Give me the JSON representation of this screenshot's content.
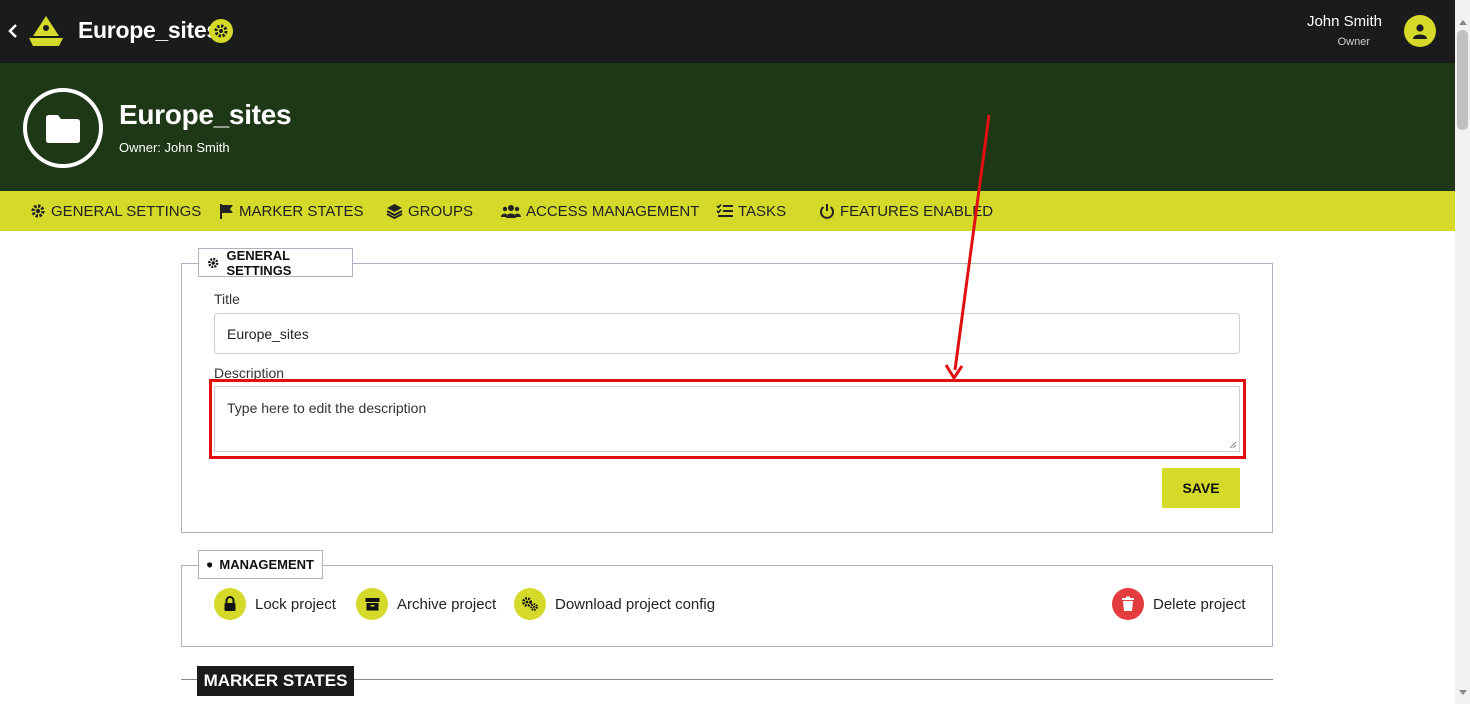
{
  "topbar": {
    "app_title": "Europe_sites",
    "user_name": "John Smith",
    "user_role": "Owner"
  },
  "header": {
    "project_title": "Europe_sites",
    "owner_line": "Owner: John Smith"
  },
  "tabs": [
    {
      "label": "GENERAL SETTINGS",
      "icon": "gear-icon"
    },
    {
      "label": "MARKER STATES",
      "icon": "flag-icon"
    },
    {
      "label": "GROUPS",
      "icon": "layers-icon"
    },
    {
      "label": "ACCESS MANAGEMENT",
      "icon": "users-icon"
    },
    {
      "label": "TASKS",
      "icon": "checklist-icon"
    },
    {
      "label": "FEATURES ENABLED",
      "icon": "power-icon"
    }
  ],
  "general_settings": {
    "legend": "GENERAL SETTINGS",
    "title_label": "Title",
    "title_value": "Europe_sites",
    "description_label": "Description",
    "description_placeholder": "Type here to edit the description",
    "save_label": "SAVE"
  },
  "management": {
    "legend": "MANAGEMENT",
    "actions": [
      {
        "label": "Lock project",
        "icon": "lock-icon"
      },
      {
        "label": "Archive project",
        "icon": "archive-icon"
      },
      {
        "label": "Download project config",
        "icon": "gears-icon"
      },
      {
        "label": "Delete project",
        "icon": "trash-icon"
      }
    ]
  },
  "marker_states": {
    "heading": "MARKER STATES"
  },
  "colors": {
    "accent": "#d4d92a",
    "topbar": "#1b1b1b",
    "header": "#1e3817",
    "danger": "#e23c3c",
    "annotation": "#e01010"
  }
}
